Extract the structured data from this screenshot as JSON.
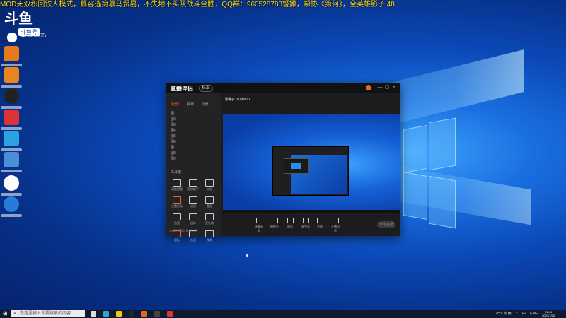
{
  "marquee": "MOD无双积回铁人模式，慕容选第慕马贸易，不失地不买队战斗全胜，QQ群：960528780督撒，帮协《第何》，全英雄影子!48",
  "overlay": {
    "brand": "斗鱼",
    "tag": "斗鱼号",
    "room_id": "4639665"
  },
  "app": {
    "name": "直播伴侣",
    "badge": "标准",
    "window_controls": [
      "—",
      "▢",
      "✕"
    ],
    "sidebar_tabs": [
      "场景1",
      "弹幕",
      "场景"
    ],
    "sidebar_items": [
      "图1",
      "图2",
      "图3",
      "图4",
      "图5",
      "图6",
      "图7",
      "图8",
      "图9"
    ],
    "tools_header": "工具箱",
    "tools": [
      "高能提醒",
      "直播助手",
      "公告",
      "主播活动",
      "语音",
      "截图",
      "贴图",
      "鼠标",
      "获礼物",
      "图标",
      "连麦",
      "视频"
    ],
    "bottom_note": "1.标题设置与直播信息",
    "room_title": "聚焦[1180]MOD",
    "ctrl_labels": [
      "场景画面",
      "摄像头",
      "窗口",
      "麦克风",
      "音效",
      "开播设置"
    ],
    "live_button": "开始直播"
  },
  "taskbar": {
    "search_placeholder": "在这里输入你要搜索的内容",
    "tray_items": [
      "25°C 有雨",
      "^",
      "中",
      "ENG"
    ],
    "clock_time": "21:41",
    "clock_date": "2021/7/20"
  },
  "colors": {
    "accent": "#ff5a2c",
    "marquee": "#ffd900"
  }
}
